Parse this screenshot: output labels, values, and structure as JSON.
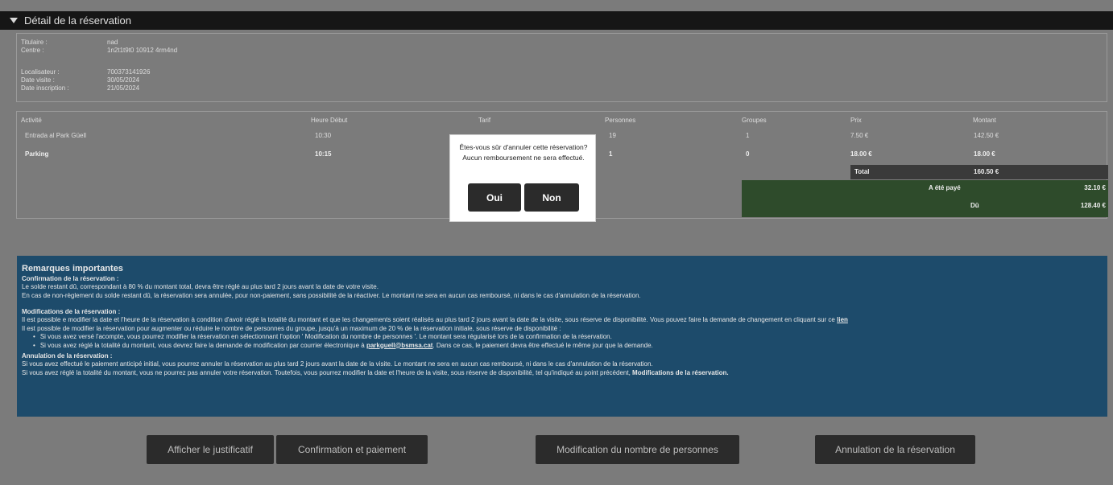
{
  "header": {
    "title": "Détail de la réservation"
  },
  "info": [
    {
      "label": "Titulaire :",
      "value": "nad"
    },
    {
      "label": "Centre :",
      "value": "1n2t1t9t0 10912 4rm4nd"
    },
    {
      "label": "Localisateur :",
      "value": "700373141926"
    },
    {
      "label": "Date visite :",
      "value": "30/05/2024"
    },
    {
      "label": "Date inscription :",
      "value": "21/05/2024"
    }
  ],
  "table": {
    "headers": [
      "Activité",
      "Heure Début",
      "Tarif",
      "Personnes",
      "Groupes",
      "Prix",
      "Montant"
    ],
    "rows": [
      {
        "activity": "Entrada al Park Güell",
        "time": "10:30",
        "persons": "19",
        "groups": "1",
        "price": "7.50 €",
        "amount": "142.50 €"
      },
      {
        "activity": "Parking",
        "time": "10:15",
        "persons": "1",
        "groups": "0",
        "price": "18.00 €",
        "amount": "18.00 €"
      }
    ],
    "total_label": "Total",
    "total_value": "160.50 €",
    "paid_label": "A été payé",
    "paid_value": "32.10 €",
    "due_label": "Dû",
    "due_value": "128.40 €"
  },
  "modal": {
    "message": "Êtes-vous sûr d'annuler cette réservation? Aucun remboursement ne sera effectué.",
    "yes": "Oui",
    "no": "Non"
  },
  "remarks": {
    "title": "Remarques importantes",
    "s1_head": "Confirmation de la réservation :",
    "s1_l1": "Le solde restant dû, correspondant à 80 % du montant total, devra être réglé au plus tard 2 jours avant la date de votre visite.",
    "s1_l2": "En cas de non-règlement du solde restant dû, la réservation sera annulée, pour non-paiement, sans possibilité de la réactiver. Le montant ne sera en aucun cas remboursé, ni dans le cas d'annulation de la réservation.",
    "s2_head": "Modifications de la réservation :",
    "s2_l1": "Il est possible e modifier la date et l'heure de la réservation à condition d'avoir réglé la totalité du montant et que les changements soient réalisés au plus tard 2 jours avant la date de la visite, sous réserve de disponibilité. Vous pouvez faire la demande de changement en cliquant sur ce",
    "s2_link": "lien",
    "s2_l2": "Il est possible de modifier la réservation pour augmenter ou réduire le nombre de personnes du groupe, jusqu'à un maximum de 20 % de la réservation initiale, sous réserve de disponibilité :",
    "s2_b1": "Si vous avez versé l'acompte, vous pourrez modifier la réservation en sélectionnant l'option ' Modification du nombre de personnes '. Le montant sera régularisé lors de la confirmation de la réservation.",
    "s2_b2_pre": "Si vous avez réglé la totalité du montant, vous devrez faire la demande de modification par courrier électronique à",
    "s2_b2_email": "parkguell@bsmsa.cat",
    "s2_b2_post": ". Dans ce cas, le paiement devra être effectué le même jour que la demande.",
    "s3_head": "Annulation de la réservation :",
    "s3_l1": "Si vous avez effectué le paiement anticipé initial, vous pourrez annuler la réservation au plus tard 2 jours avant la date de la visite. Le montant ne sera en aucun cas remboursé, ni dans le cas d'annulation de la réservation.",
    "s3_l2_pre": "Si vous avez réglé la totalité du montant, vous ne pourrez pas annuler votre réservation. Toutefois, vous pourrez modifier la date et l'heure de la visite, sous réserve de disponibilité, tel qu'indiqué au point précédent,",
    "s3_l2_bold": "Modifications de la réservation."
  },
  "actions": {
    "receipt": "Afficher le justificatif",
    "confirm_pay": "Confirmation et paiement",
    "modify_people": "Modification du nombre de personnes",
    "cancel": "Annulation de la réservation"
  }
}
